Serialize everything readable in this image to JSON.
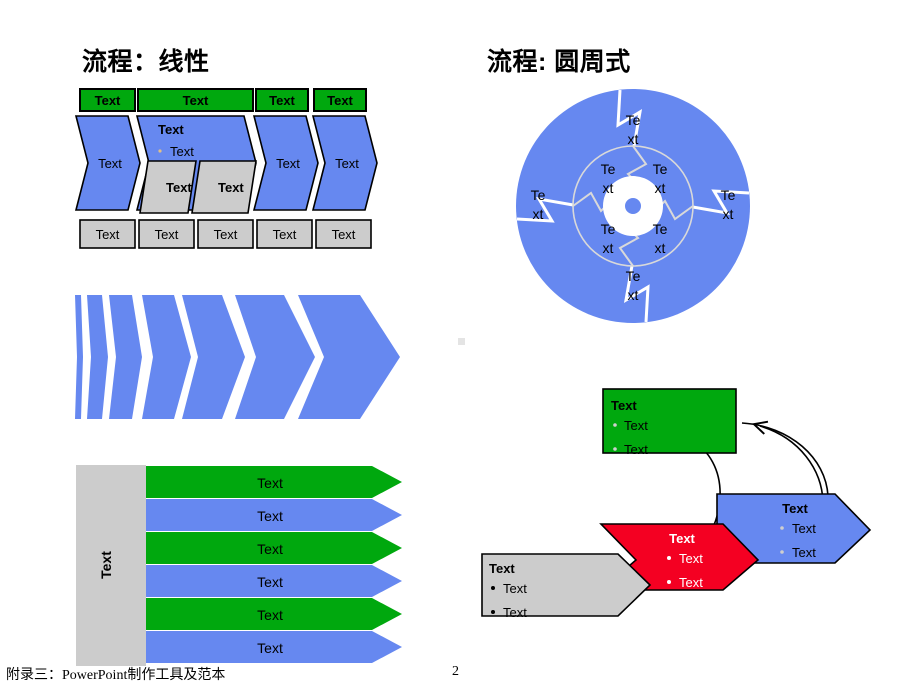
{
  "slide": {
    "page_number": "2",
    "footer_text": "附录三：PowerPoint制作工具及范本",
    "background": "#ffffff"
  },
  "titles": {
    "left": "流程：线性",
    "right": "流程: 圆周式"
  },
  "colors": {
    "green": "#00A80E",
    "blue": "#6688F0",
    "gray": "#CCCCCC",
    "red": "#F40022",
    "outline": "#000000",
    "ring_line": "#D9D9D9"
  },
  "linear_process": {
    "top_labels": [
      "Text",
      "Text",
      "Text",
      "Text"
    ],
    "chevrons": [
      {
        "label": "Text"
      },
      {
        "label": "Text",
        "sub_bullet": "Text"
      },
      {
        "label": "Text"
      },
      {
        "label": "Text"
      }
    ],
    "inner_gray_shapes": [
      "Text",
      "Text"
    ],
    "bottom_boxes": [
      "Text",
      "Text",
      "Text",
      "Text",
      "Text"
    ]
  },
  "chevron_growth": {
    "count": 7,
    "color": "#6688F0"
  },
  "arrow_stack": {
    "side_label": "Text",
    "rows": [
      {
        "label": "Text",
        "color": "green"
      },
      {
        "label": "Text",
        "color": "blue"
      },
      {
        "label": "Text",
        "color": "green"
      },
      {
        "label": "Text",
        "color": "blue"
      },
      {
        "label": "Text",
        "color": "green"
      },
      {
        "label": "Text",
        "color": "blue"
      }
    ]
  },
  "circular_process": {
    "outer_labels": [
      "Te\nxt",
      "Te\nxt",
      "Te\nxt",
      "Te\nxt"
    ],
    "outer": [
      {
        "line1": "Te",
        "line2": "xt"
      },
      {
        "line1": "Te",
        "line2": "xt"
      },
      {
        "line1": "Te",
        "line2": "xt"
      },
      {
        "line1": "Te",
        "line2": "xt"
      }
    ],
    "inner": [
      {
        "line1": "Te",
        "line2": "xt"
      },
      {
        "line1": "Te",
        "line2": "xt"
      },
      {
        "line1": "Te",
        "line2": "xt"
      },
      {
        "line1": "Te",
        "line2": "xt"
      }
    ]
  },
  "cycle_blocks": [
    {
      "name": "green-block",
      "title": "Text",
      "bullets": [
        "Text",
        "Text"
      ],
      "color": "#00A80E",
      "text_color": "#000000"
    },
    {
      "name": "blue-block",
      "title": "Text",
      "bullets": [
        "Text",
        "Text"
      ],
      "color": "#6688F0",
      "text_color": "#000000"
    },
    {
      "name": "red-block",
      "title": "Text",
      "bullets": [
        "Text",
        "Text"
      ],
      "color": "#F40022",
      "text_color": "#ffffff"
    },
    {
      "name": "gray-block",
      "title": "Text",
      "bullets": [
        "Text",
        "Text"
      ],
      "color": "#CCCCCC",
      "text_color": "#000000"
    }
  ]
}
